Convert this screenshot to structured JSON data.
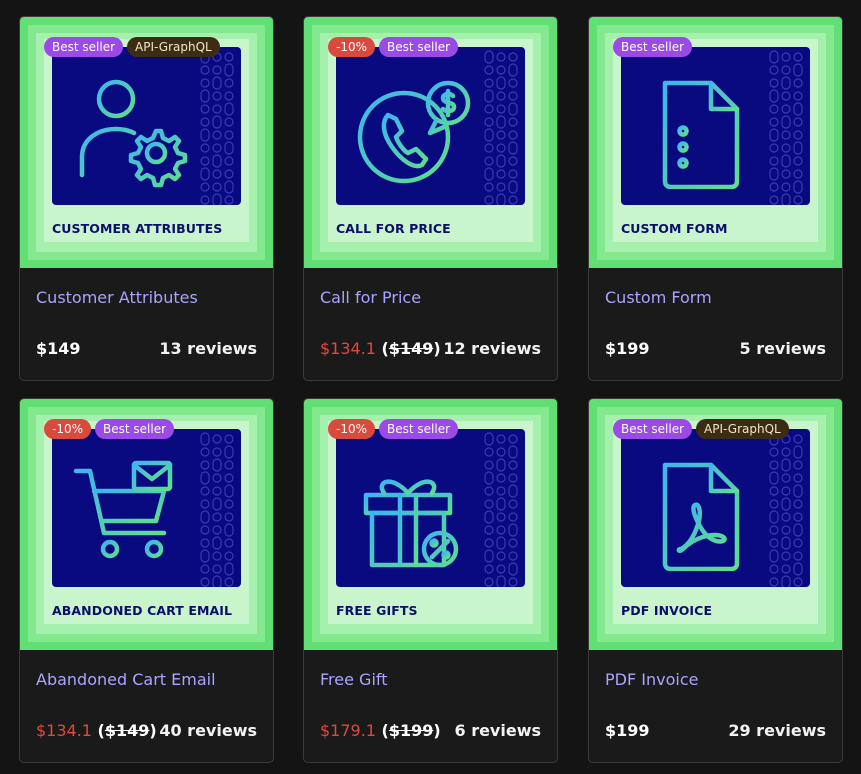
{
  "products": [
    {
      "caption": "CUSTOMER ATTRIBUTES",
      "badges": [
        {
          "type": "bestseller",
          "label": "Best seller"
        },
        {
          "type": "api",
          "label": "API-GraphQL"
        }
      ],
      "name": "Customer Attributes",
      "price": "$149",
      "sale_price": "",
      "original_price": "",
      "reviews": "13 reviews",
      "icon": "user-gear-icon"
    },
    {
      "caption": "CALL FOR PRICE",
      "badges": [
        {
          "type": "discount",
          "label": "-10%"
        },
        {
          "type": "bestseller",
          "label": "Best seller"
        }
      ],
      "name": "Call for Price",
      "price": "",
      "sale_price": "$134.1",
      "original_price": "$149",
      "reviews": "12 reviews",
      "icon": "phone-dollar-icon"
    },
    {
      "caption": "CUSTOM FORM",
      "badges": [
        {
          "type": "bestseller",
          "label": "Best seller"
        }
      ],
      "name": "Custom Form",
      "price": "$199",
      "sale_price": "",
      "original_price": "",
      "reviews": "5 reviews",
      "icon": "form-document-icon"
    },
    {
      "caption": "ABANDONED CART EMAIL",
      "badges": [
        {
          "type": "discount",
          "label": "-10%"
        },
        {
          "type": "bestseller",
          "label": "Best seller"
        }
      ],
      "name": "Abandoned Cart Email",
      "price": "",
      "sale_price": "$134.1",
      "original_price": "$149",
      "reviews": "40 reviews",
      "icon": "cart-email-icon"
    },
    {
      "caption": "FREE GIFTS",
      "badges": [
        {
          "type": "discount",
          "label": "-10%"
        },
        {
          "type": "bestseller",
          "label": "Best seller"
        }
      ],
      "name": "Free Gift",
      "price": "",
      "sale_price": "$179.1",
      "original_price": "$199",
      "reviews": "6 reviews",
      "icon": "gift-percent-icon"
    },
    {
      "caption": "PDF INVOICE",
      "badges": [
        {
          "type": "bestseller",
          "label": "Best seller"
        },
        {
          "type": "api",
          "label": "API-GraphQL"
        }
      ],
      "name": "PDF Invoice",
      "price": "$199",
      "sale_price": "",
      "original_price": "",
      "reviews": "29 reviews",
      "icon": "pdf-document-icon"
    }
  ],
  "colors": {
    "background": "#141414",
    "thumb_green": "#62df74",
    "panel_navy": "#0a0a80",
    "title_purple": "#a9a4ff",
    "sale_red": "#e4473b",
    "badge_discount": "#d94a3c",
    "badge_bestseller": "#9b4ae8",
    "badge_api": "#3d2c14"
  }
}
